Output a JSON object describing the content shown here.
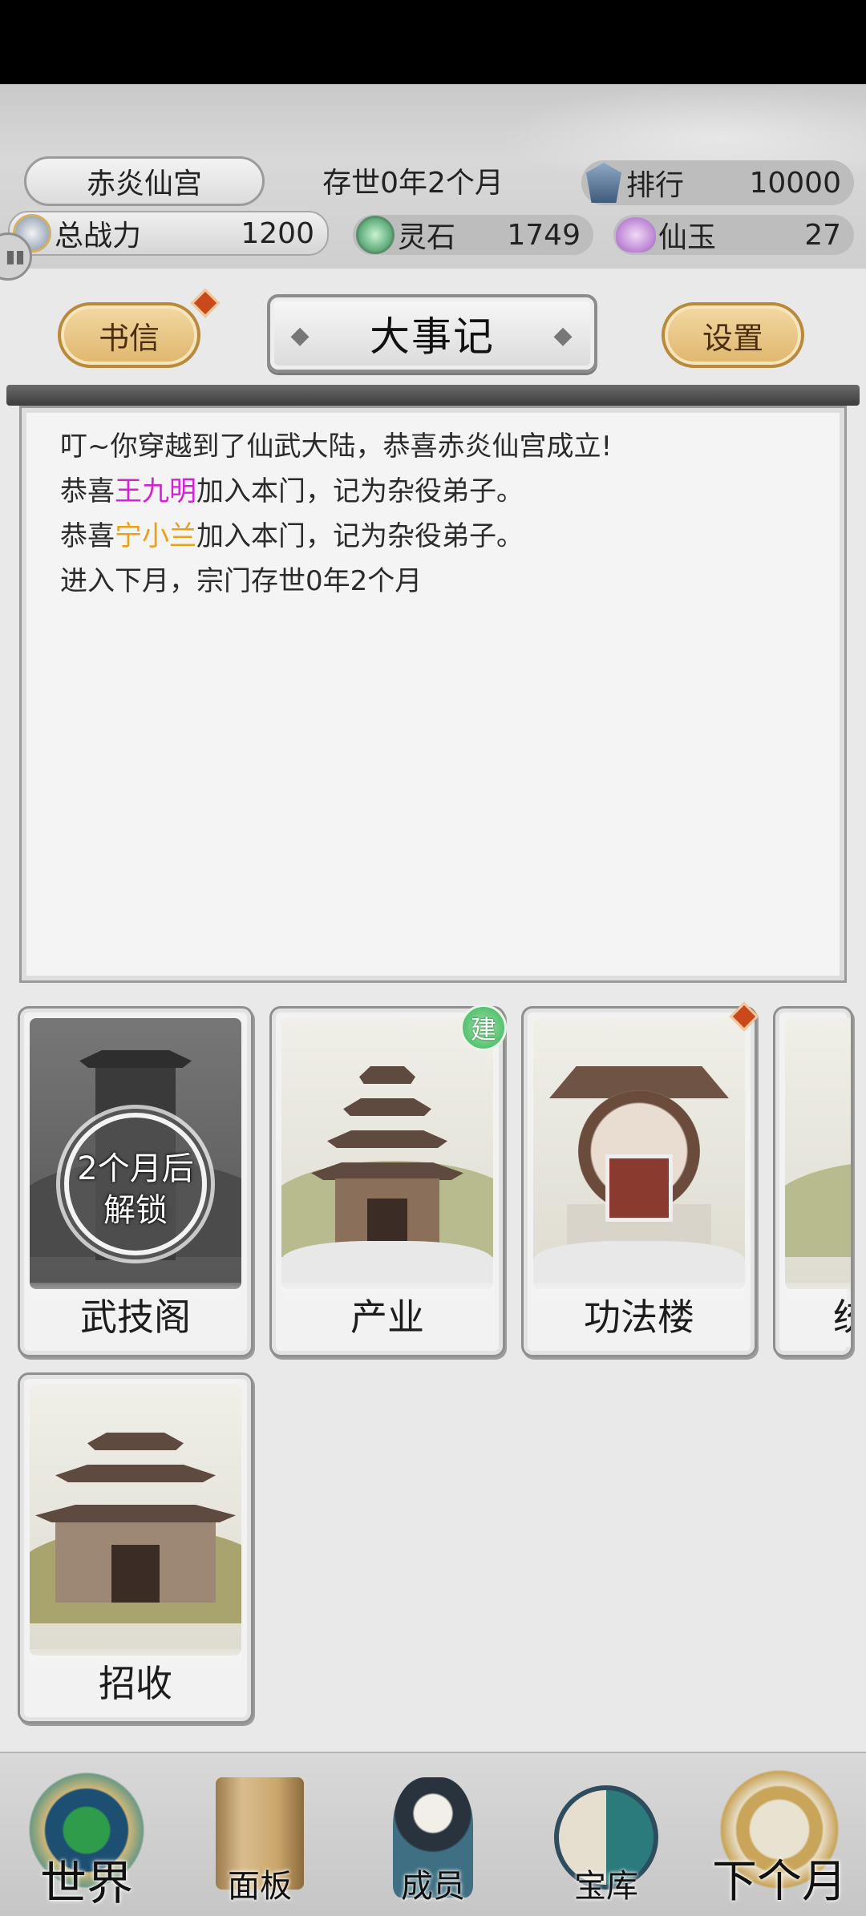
{
  "header": {
    "sect_name": "赤炎仙宫",
    "sect_age": "存世0年2个月",
    "rank": {
      "label": "排行",
      "value": "10000",
      "icon": "rank-pagoda-icon"
    },
    "power": {
      "label": "总战力",
      "value": "1200",
      "icon": "power-shield-icon"
    },
    "spirit_stone": {
      "label": "灵石",
      "value": "1749",
      "icon": "spirit-stone-icon"
    },
    "immortal_jade": {
      "label": "仙玉",
      "value": "27",
      "icon": "immortal-jade-icon"
    }
  },
  "titlebar": {
    "letters_label": "书信",
    "title": "大事记",
    "settings_label": "设置",
    "ornament": "◆"
  },
  "log": {
    "line1": "叮~你穿越到了仙武大陆，恭喜赤炎仙宫成立!",
    "line2_prefix": "恭喜",
    "line2_name": "王九明",
    "line2_suffix": "加入本门，记为杂役弟子。",
    "line3_prefix": "恭喜",
    "line3_name": "宁小兰",
    "line3_suffix": "加入本门，记为杂役弟子。",
    "line4": "进入下月，宗门存世0年2个月",
    "name_colors": {
      "wang": "#d81fd8",
      "ning": "#e7a11a"
    }
  },
  "buildings": {
    "martial_pavilion": {
      "label": "武技阁",
      "lock_line1": "2个月后",
      "lock_line2": "解锁"
    },
    "industry": {
      "label": "产业",
      "badge": "建"
    },
    "technique_tower": {
      "label": "功法楼"
    },
    "partial_card": {
      "label": "统"
    },
    "recruit": {
      "label": "招收"
    }
  },
  "bottom_nav": {
    "world": "世界",
    "panel": "面板",
    "members": "成员",
    "vault": "宝库",
    "next_month": "下个月"
  },
  "colors": {
    "accent_gold": "#dfb66c",
    "badge_red": "#c9491c",
    "build_green": "#39b35a"
  }
}
